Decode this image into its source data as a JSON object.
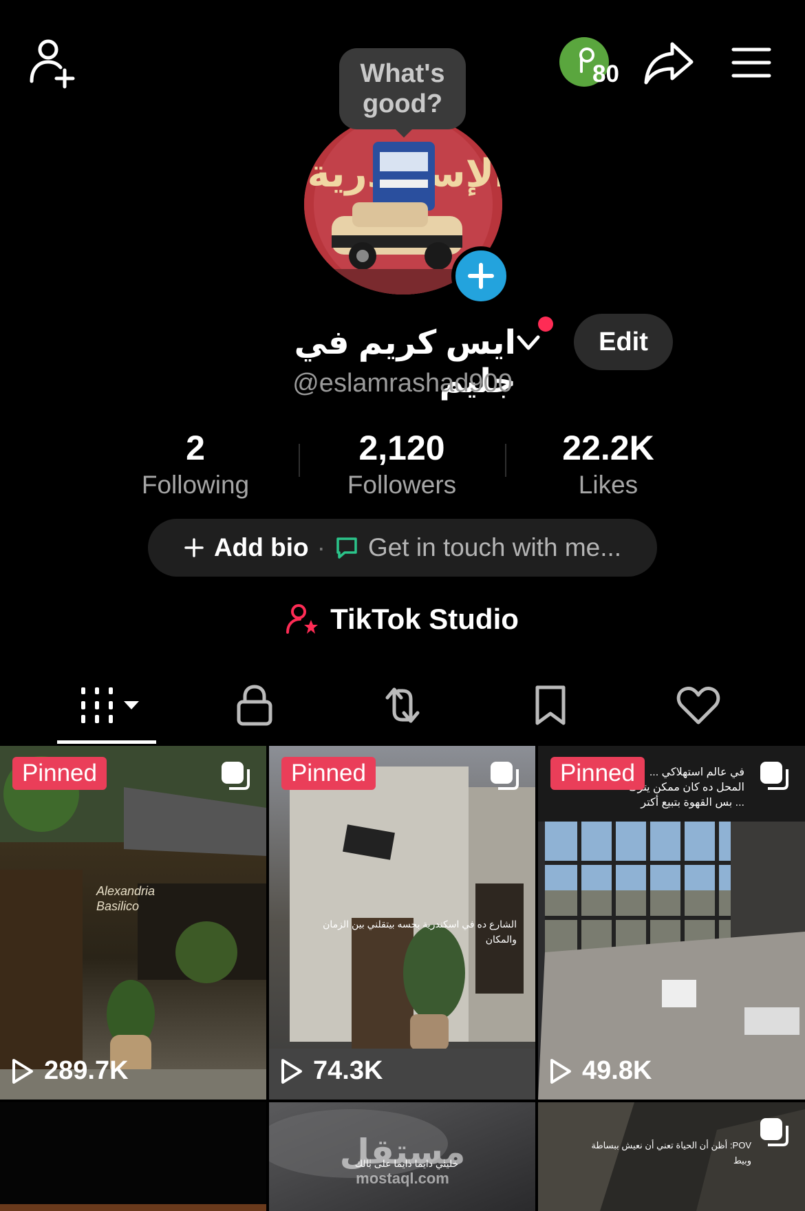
{
  "tooltip": {
    "text": "What's good?"
  },
  "coins": {
    "count": "80"
  },
  "profile": {
    "name": "ايس كريم في جليم",
    "handle": "@eslamrashad900",
    "edit_label": "Edit"
  },
  "stats": [
    {
      "value": "2",
      "label": "Following"
    },
    {
      "value": "2,120",
      "label": "Followers"
    },
    {
      "value": "22.2K",
      "label": "Likes"
    }
  ],
  "bio": {
    "add_label": "Add bio",
    "separator": "·",
    "touch_label": "Get in touch with me..."
  },
  "studio": {
    "label": "TikTok Studio"
  },
  "tabs": [
    {
      "icon": "grid-icon",
      "active": true
    },
    {
      "icon": "lock-icon",
      "active": false
    },
    {
      "icon": "repost-icon",
      "active": false
    },
    {
      "icon": "bookmark-icon",
      "active": false
    },
    {
      "icon": "heart-icon",
      "active": false
    }
  ],
  "videos": [
    {
      "pinned": "Pinned",
      "views": "289.7K",
      "caption": "Alexandria Basilico"
    },
    {
      "pinned": "Pinned",
      "views": "74.3K",
      "caption": "الشارع ده في اسكندرية بحسه بيتقلني بين الزمان والمكان"
    },
    {
      "pinned": "Pinned",
      "views": "49.8K",
      "caption": "في عالم استهلاكي ... المحل ده كان ممكن يترك ... بس القهوة بتبيع أكتر"
    },
    {
      "caption": ""
    },
    {
      "caption": "خليني دايما دايما على بالك"
    },
    {
      "caption": "POV: أظن أن الحياة تعني أن نعيش ببساطة وبيط"
    }
  ],
  "watermark": {
    "arabic": "مستقل",
    "latin": "mostaql.com"
  },
  "colors": {
    "background": "#000000",
    "pinned": "#EA3E59",
    "notification_dot": "#FE2C55",
    "avatar_add": "#23A3DD",
    "coin": "#5AA63E"
  }
}
